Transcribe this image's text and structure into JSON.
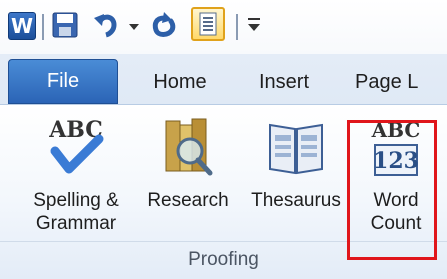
{
  "tabs": {
    "file": "File",
    "home": "Home",
    "insert": "Insert",
    "page_layout": "Page L"
  },
  "ribbon": {
    "commands": {
      "spelling": [
        "Spelling &",
        "Grammar"
      ],
      "research": [
        "Research",
        ""
      ],
      "thesaurus": [
        "Thesaurus",
        ""
      ],
      "word_count": [
        "Word",
        "Count"
      ]
    },
    "spelling_icon_text": "ABC",
    "word_count_icon_text": {
      "top": "ABC",
      "bottom": "123"
    },
    "group_label": "Proofing"
  },
  "colors": {
    "file_tab": "#2b64b6",
    "highlight": "#e0161b",
    "check": "#3a7bd5"
  },
  "icons": {
    "word": "word-app-icon",
    "save": "save-icon",
    "undo": "undo-icon",
    "redo": "redo-icon",
    "fullscreen": "full-screen-reading-icon",
    "customize": "customize-toolbar-icon"
  }
}
